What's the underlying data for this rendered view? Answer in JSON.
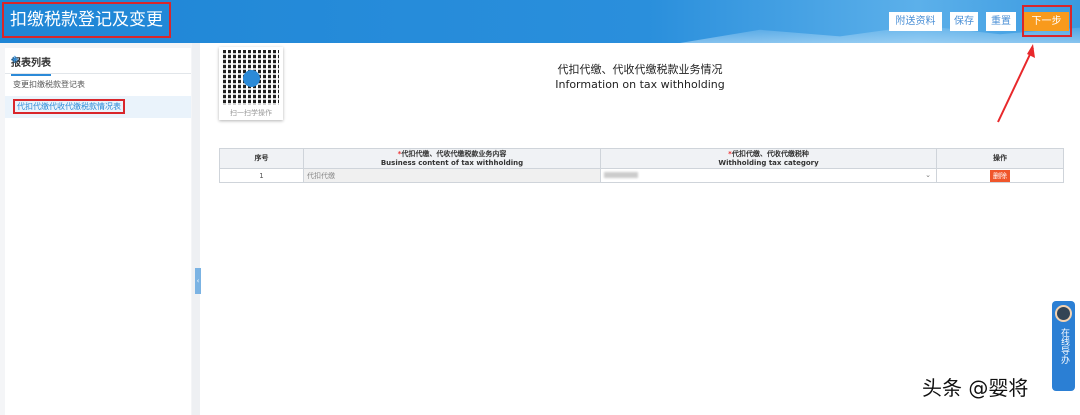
{
  "header": {
    "title": "扣缴税款登记及变更",
    "buttons": {
      "attach": "附送资料",
      "save": "保存",
      "reset": "重置",
      "next": "下一步"
    }
  },
  "sidebar": {
    "title": "报表列表",
    "items": [
      {
        "label": "变更扣缴税款登记表"
      },
      {
        "label": "代扣代缴代收代缴税款情况表"
      }
    ]
  },
  "qr": {
    "caption": "扫一扫学操作"
  },
  "main": {
    "title_cn": "代扣代缴、代收代缴税款业务情况",
    "title_en": "Information on tax withholding"
  },
  "table": {
    "headers": {
      "no": "序号",
      "content_cn": "代扣代缴、代收代缴税款业务内容",
      "content_en": "Business content of tax withholding",
      "category_cn": "代扣代缴、代收代缴税种",
      "category_en": "Withholding tax category",
      "action": "操作",
      "required": "*"
    },
    "rows": [
      {
        "no": "1",
        "content": "代扣代缴",
        "delete": "删除"
      }
    ]
  },
  "online_help": "在线导办",
  "watermark": "头条 @婴将"
}
